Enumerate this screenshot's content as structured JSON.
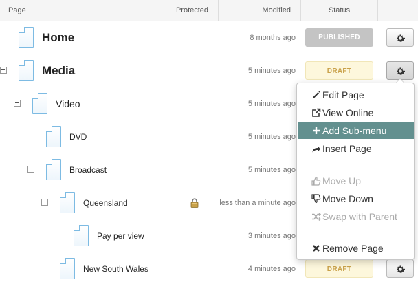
{
  "header": {
    "page": "Page",
    "protected": "Protected",
    "modified": "Modified",
    "status": "Status"
  },
  "rows": [
    {
      "name": "Home",
      "modified": "8 months ago",
      "status": "PUBLISHED",
      "status_kind": "published"
    },
    {
      "name": "Media",
      "modified": "5 minutes ago",
      "status": "DRAFT",
      "status_kind": "draft"
    },
    {
      "name": "Video",
      "modified": "5 minutes ago"
    },
    {
      "name": "DVD",
      "modified": "5 minutes ago"
    },
    {
      "name": "Broadcast",
      "modified": "5 minutes ago"
    },
    {
      "name": "Queensland",
      "modified": "less than a minute ago",
      "protected_icon": "lock-icon"
    },
    {
      "name": "Pay per view",
      "modified": "3 minutes ago"
    },
    {
      "name": "New South Wales",
      "modified": "4 minutes ago",
      "status": "DRAFT",
      "status_kind": "draft"
    }
  ],
  "menu": {
    "items": [
      {
        "label": "Edit Page",
        "icon": "pencil-icon",
        "state": "normal"
      },
      {
        "label": "View Online",
        "icon": "external-link-icon",
        "state": "normal"
      },
      {
        "label": "Add Sub-menu",
        "icon": "plus-icon",
        "state": "highlighted"
      },
      {
        "label": "Insert Page",
        "icon": "share-arrow-icon",
        "state": "normal"
      },
      {
        "label": "Move Up",
        "icon": "thumb-up-icon",
        "state": "disabled"
      },
      {
        "label": "Move Down",
        "icon": "thumb-down-icon",
        "state": "normal"
      },
      {
        "label": "Swap with Parent",
        "icon": "shuffle-icon",
        "state": "disabled"
      },
      {
        "label": "Remove Page",
        "icon": "remove-x-icon",
        "state": "normal"
      }
    ]
  },
  "colors": {
    "highlight": "#63908f",
    "draft_bg": "#fdf7dc",
    "draft_text": "#c9a14a",
    "published_bg": "#c4c4c4",
    "page_icon_border": "#7dbbe3"
  }
}
